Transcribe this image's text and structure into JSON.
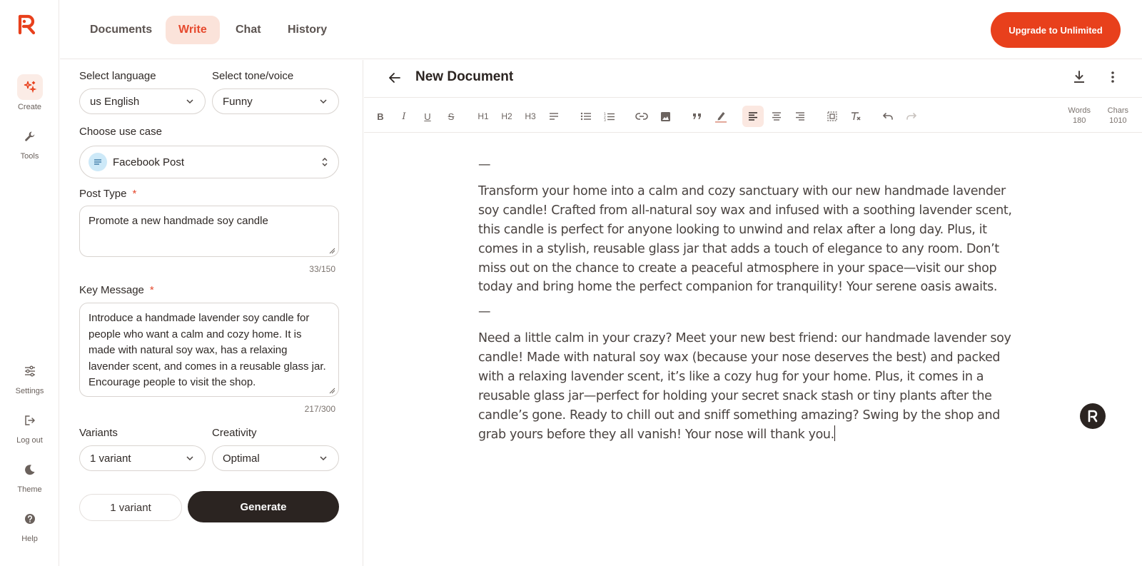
{
  "rail": {
    "items": [
      {
        "label": "Create",
        "icon": "sparkle-icon"
      },
      {
        "label": "Tools",
        "icon": "wrench-icon"
      },
      {
        "label": "Settings",
        "icon": "sliders-icon"
      },
      {
        "label": "Log out",
        "icon": "logout-icon"
      },
      {
        "label": "Theme",
        "icon": "moon-icon"
      },
      {
        "label": "Help",
        "icon": "help-icon"
      }
    ]
  },
  "tabs": [
    {
      "label": "Documents"
    },
    {
      "label": "Write"
    },
    {
      "label": "Chat"
    },
    {
      "label": "History"
    }
  ],
  "active_tab": "Write",
  "upgrade_label": "Upgrade to Unlimited",
  "form": {
    "language_label": "Select language",
    "language_value": "us English",
    "tone_label": "Select tone/voice",
    "tone_value": "Funny",
    "usecase_label": "Choose use case",
    "usecase_value": "Facebook Post",
    "post_type_label": "Post Type",
    "post_type_value": "Promote a new handmade soy candle",
    "post_type_count": "33/150",
    "key_message_label": "Key Message",
    "key_message_value": "Introduce a handmade lavender soy candle for people who want a calm and cozy home. It is made with natural soy wax, has a relaxing lavender scent, and comes in a reusable glass jar. Encourage people to visit the shop.",
    "key_message_count": "217/300",
    "required_mark": "*",
    "variants_label": "Variants",
    "variants_value": "1 variant",
    "creativity_label": "Creativity",
    "creativity_value": "Optimal",
    "variant_button": "1 variant",
    "generate_button": "Generate"
  },
  "editor": {
    "title": "New Document",
    "words_label": "Words",
    "words_value": "180",
    "chars_label": "Chars",
    "chars_value": "1010",
    "separator": "—",
    "paragraph_1": "Transform your home into a calm and cozy sanctuary with our new handmade lavender soy candle! Crafted from all-natural soy wax and infused with a soothing lavender scent, this candle is perfect for anyone looking to unwind and relax after a long day. Plus, it comes in a stylish, reusable glass jar that adds a touch of elegance to any room. Don’t miss out on the chance to create a peaceful atmosphere in your space—visit our shop today and bring home the perfect companion for tranquility! Your serene oasis awaits.",
    "paragraph_2": "Need a little calm in your crazy? Meet your new best friend: our handmade lavender soy candle! Made with natural soy wax (because your nose deserves the best) and packed with a relaxing lavender scent, it’s like a cozy hug for your home. Plus, it comes in a reusable glass jar—perfect for holding your secret snack stash or tiny plants after the candle’s gone. Ready to chill out and sniff something amazing? Swing by the shop and grab yours before they all vanish! Your nose will thank you.",
    "toolbar": {
      "bold": "B",
      "italic": "I",
      "underline": "U",
      "strike": "S",
      "h1": "H1",
      "h2": "H2",
      "h3": "H3"
    }
  },
  "colors": {
    "accent": "#e8401c",
    "dark": "#2b2421",
    "active_tab_bg": "#fbe3da"
  }
}
